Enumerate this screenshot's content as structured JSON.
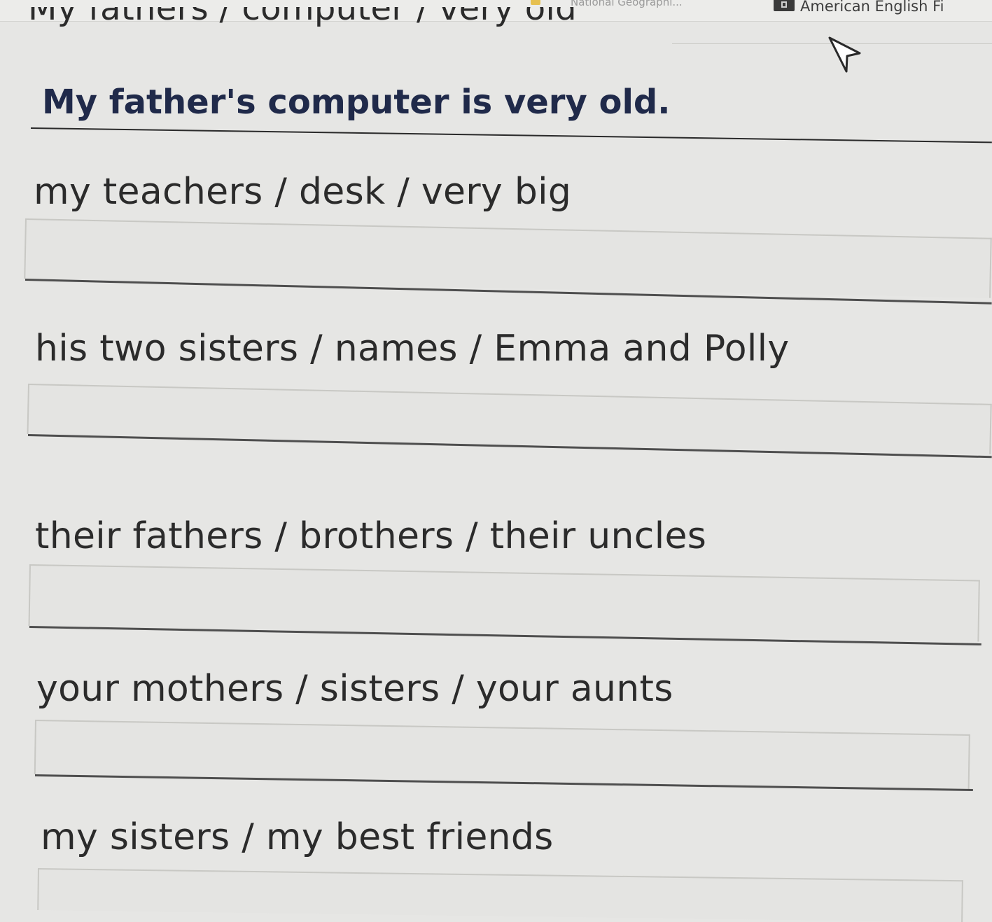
{
  "bookmarks": {
    "faded_item": "National Geographi...",
    "item": "American English Fi"
  },
  "worksheet": {
    "example_prompt": "My fathers / computer / very old",
    "example_answer": "My father's computer is very old.",
    "items": [
      {
        "prompt": "my teachers / desk / very big",
        "answer": ""
      },
      {
        "prompt": "his two sisters / names / Emma and Polly",
        "answer": ""
      },
      {
        "prompt": "their fathers / brothers / their uncles",
        "answer": ""
      },
      {
        "prompt": "your mothers / sisters / your aunts",
        "answer": ""
      },
      {
        "prompt": "my sisters / my best friends",
        "answer": ""
      }
    ]
  }
}
